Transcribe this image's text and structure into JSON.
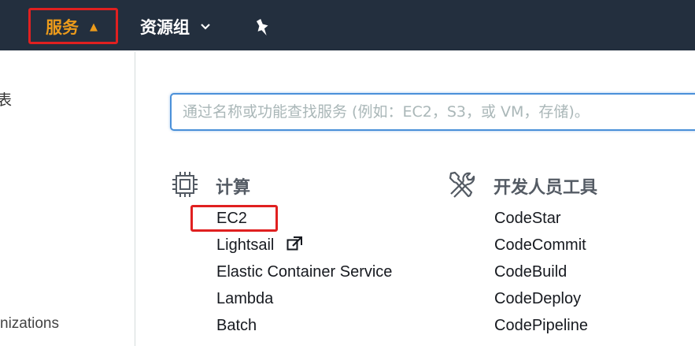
{
  "topnav": {
    "services_label": "服务",
    "resource_groups_label": "资源组",
    "icons": {
      "services_caret": "caret-up-icon",
      "groups_caret": "chevron-down-icon",
      "pin": "pin-icon"
    },
    "accent_color": "#ec9b1b",
    "background_color": "#232f3e"
  },
  "sidebar": {
    "fragment_top": "表",
    "fragment_bottom": "nizations"
  },
  "search": {
    "placeholder": "通过名称或功能查找服务 (例如：EC2，S3，或 VM，存储)。",
    "value": ""
  },
  "sections": {
    "compute": {
      "title": "计算",
      "icon": "chip-icon",
      "items": [
        "EC2",
        "Lightsail",
        "Elastic Container Service",
        "Lambda",
        "Batch"
      ],
      "external_link_icon_on": "Lightsail"
    },
    "developer_tools": {
      "title": "开发人员工具",
      "icon": "tools-icon",
      "items": [
        "CodeStar",
        "CodeCommit",
        "CodeBuild",
        "CodeDeploy",
        "CodePipeline"
      ]
    }
  },
  "highlight_color": "#e02020"
}
